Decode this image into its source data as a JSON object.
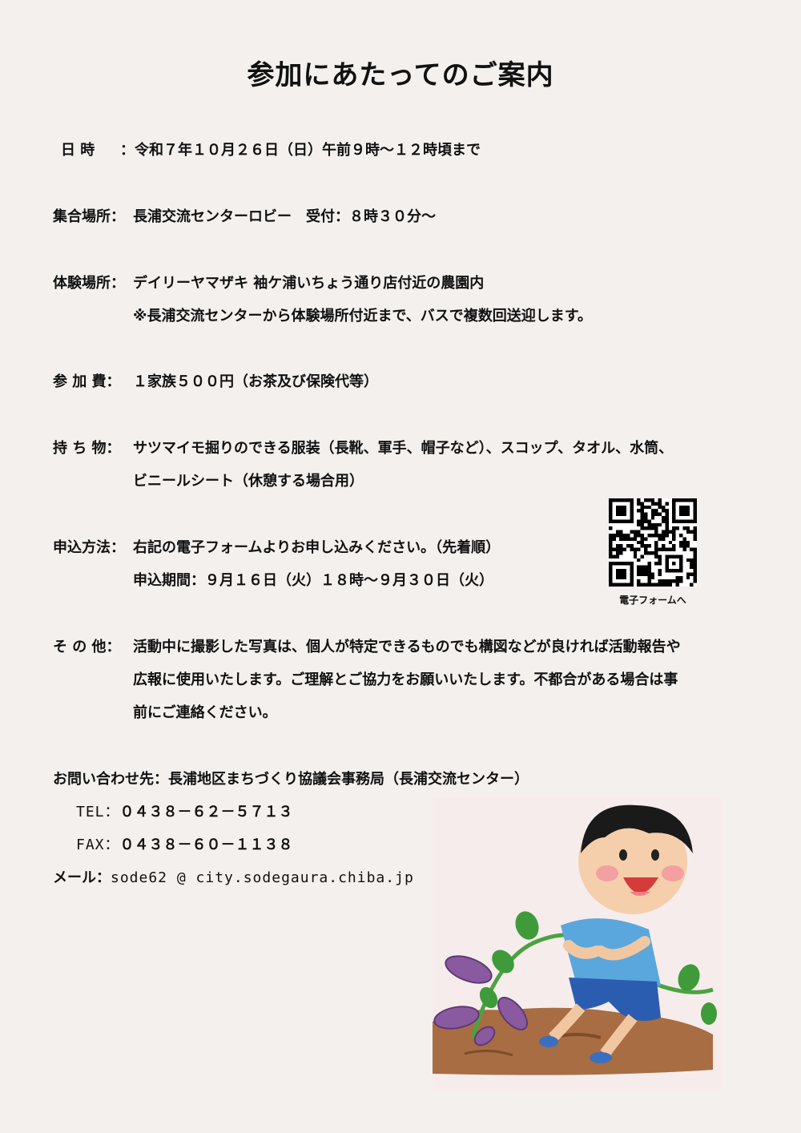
{
  "title": "参加にあたってのご案内",
  "datetime": {
    "label": "日 時",
    "value": "：令和７年１０月２６日（日）午前９時～１２時頃まで"
  },
  "meeting": {
    "label": "集合場所：",
    "value": "長浦交流センターロビー　受付：８時３０分～"
  },
  "venue": {
    "label": "体験場所：",
    "value": "デイリーヤマザキ 袖ケ浦いちょう通り店付近の農園内",
    "note": "※長浦交流センターから体験場所付近まで、バスで複数回送迎します。"
  },
  "fee": {
    "label": "参 加 費：",
    "value": "１家族５００円（お茶及び保険代等）"
  },
  "belongings": {
    "label": "持 ち 物：",
    "line1": "サツマイモ掘りのできる服装（長靴、軍手、帽子など）、スコップ、タオル、水筒、",
    "line2": "ビニールシート（休憩する場合用）"
  },
  "apply": {
    "label": "申込方法：",
    "line1": "右記の電子フォームよりお申し込みください。（先着順）",
    "line2": "申込期間：９月１６日（火）１８時～９月３０日（火）",
    "qr_caption": "電子フォームへ"
  },
  "other": {
    "label": "そ の 他：",
    "line1": "活動中に撮影した写真は、個人が特定できるものでも構図などが良ければ活動報告や",
    "line2": "広報に使用いたします。ご理解とご協力をお願いいたします。不都合がある場合は事",
    "line3": "前にご連絡ください。"
  },
  "contact": {
    "heading": "お問い合わせ先：長浦地区まちづくり協議会事務局（長浦交流センター）",
    "tel_label": "TEL：",
    "tel": "０４３８－６２－５７１３",
    "fax_label": "FAX：",
    "fax": "０４３８－６０－１１３８",
    "mail_label": "メール：",
    "mail": "sode62 @ city.sodegaura.chiba.jp"
  },
  "colors": {
    "background": "#f4f0ed",
    "text": "#111111",
    "shirt": "#5aa7de",
    "shorts": "#2a5db0",
    "soil": "#a26b40",
    "potato": "#8a5aa0",
    "leaf": "#3f9b3a"
  }
}
